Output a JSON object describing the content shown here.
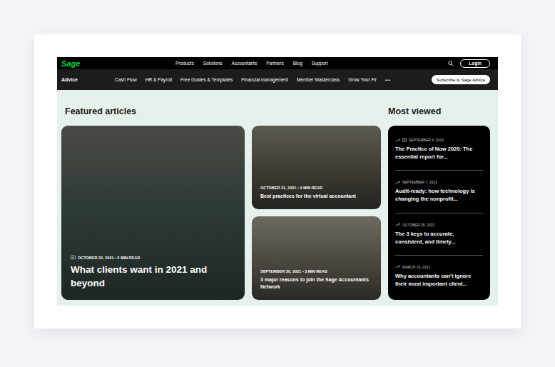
{
  "top_nav": {
    "logo": "Sage",
    "links": [
      "Products",
      "Solutions",
      "Accountants",
      "Partners",
      "Blog",
      "Support"
    ],
    "login": "Login"
  },
  "sub_nav": {
    "title": "Advice",
    "links": [
      "Cash Flow",
      "HR & Payroll",
      "Free Guides & Templates",
      "Financial management",
      "Member Masterclass",
      "Grow Your Fir"
    ],
    "more": "•••",
    "subscribe": "Subscribe to Sage Advice"
  },
  "featured": {
    "heading": "Featured articles",
    "articles": [
      {
        "kind": "large",
        "meta": "OCTOBER 22, 2021 • 2 MIN READ",
        "title": "What clients want in 2021 and beyond"
      },
      {
        "kind": "small",
        "meta": "OCTOBER 31, 2021 • 4 MIN READ",
        "title": "Best practices for the virtual accountant"
      },
      {
        "kind": "small",
        "meta": "SEPTEMBER 30, 2021 • 3 MIN READ",
        "title": "3 major reasons to join the Sage Accountants Network"
      }
    ]
  },
  "most_viewed": {
    "heading": "Most viewed",
    "items": [
      {
        "kind": "report",
        "date": "SEPTEMBER 9, 2020",
        "title": "The Practice of Now 2020: The essential report for..."
      },
      {
        "kind": "article",
        "date": "SEPTEMBER 7, 2022",
        "title": "Audit-ready: how technology is changing the nonprofit..."
      },
      {
        "kind": "article",
        "date": "OCTOBER 25, 2021",
        "title": "The 3 keys to accurate, consistent, and timely..."
      },
      {
        "kind": "article",
        "date": "MARCH 15, 2021",
        "title": "Why accountants can't ignore their most important client..."
      }
    ]
  }
}
